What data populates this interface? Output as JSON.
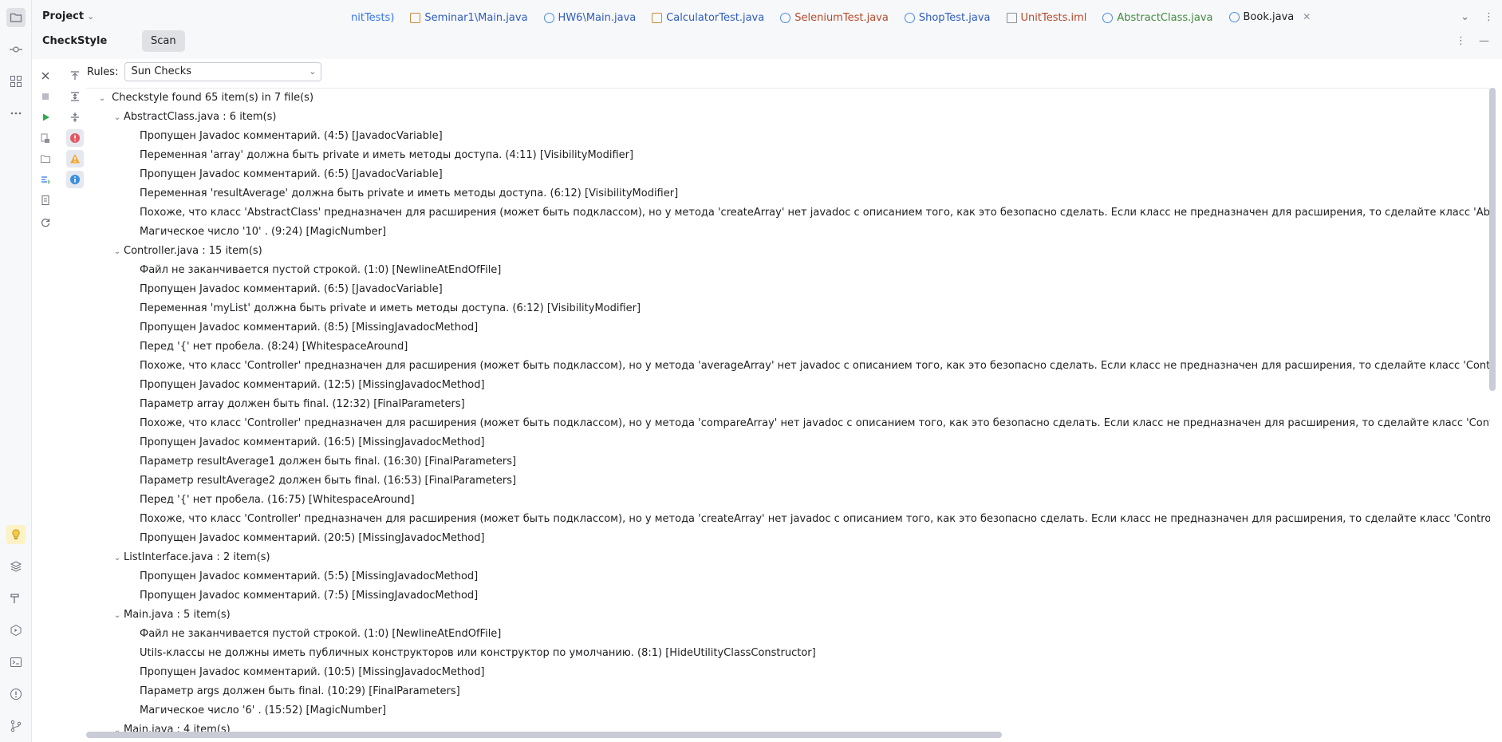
{
  "project": {
    "title": "Project"
  },
  "editor_tabs": [
    {
      "label": "nitTests)",
      "icon": "none",
      "color": "#3574f0"
    },
    {
      "label": "Seminar1\\Main.java",
      "icon": "test",
      "color": "#2f5cbf"
    },
    {
      "label": "HW6\\Main.java",
      "icon": "class",
      "color": "#2f5cbf"
    },
    {
      "label": "CalculatorTest.java",
      "icon": "test",
      "color": "#2f5cbf"
    },
    {
      "label": "SeleniumTest.java",
      "icon": "class",
      "color": "#b54a2a"
    },
    {
      "label": "ShopTest.java",
      "icon": "class",
      "color": "#2f5cbf"
    },
    {
      "label": "UnitTests.iml",
      "icon": "file",
      "color": "#b54a2a"
    },
    {
      "label": "AbstractClass.java",
      "icon": "class",
      "color": "#3f8a3f"
    },
    {
      "label": "Book.java",
      "icon": "class",
      "color": "#1e1f22",
      "active": true
    }
  ],
  "toolwindow": {
    "title": "CheckStyle",
    "tab": "Scan"
  },
  "rules": {
    "label": "Rules:",
    "selected": "Sun Checks"
  },
  "tree": {
    "root": "Checkstyle found 65 item(s) in 7 file(s)",
    "files": [
      {
        "name": "AbstractClass.java : 6 item(s)",
        "items": [
          "Пропущен Javadoc комментарий. (4:5) [JavadocVariable]",
          "Переменная 'array' должна быть private и иметь методы доступа. (4:11) [VisibilityModifier]",
          "Пропущен Javadoc комментарий. (6:5) [JavadocVariable]",
          "Переменная 'resultAverage' должна быть private и иметь методы доступа. (6:12) [VisibilityModifier]",
          "Похоже, что класс 'AbstractClass' предназначен для расширения (может быть подклассом), но у метода 'createArray' нет javadoc с описанием того, как это безопасно сделать. Если класс не предназначен для расширения, то сделайте класс 'AbstractClass' final",
          "Магическое число '10' . (9:24) [MagicNumber]"
        ]
      },
      {
        "name": "Controller.java : 15 item(s)",
        "items": [
          "Файл не заканчивается пустой строкой. (1:0) [NewlineAtEndOfFile]",
          "Пропущен Javadoc комментарий. (6:5) [JavadocVariable]",
          "Переменная 'myList' должна быть private и иметь методы доступа. (6:12) [VisibilityModifier]",
          "Пропущен Javadoc комментарий. (8:5) [MissingJavadocMethod]",
          "Перед '{' нет пробела. (8:24) [WhitespaceAround]",
          "Похоже, что класс 'Controller' предназначен для расширения (может быть подклассом), но у метода 'averageArray' нет javadoc с описанием того, как это безопасно сделать. Если класс не предназначен для расширения, то сделайте класс 'Controller' final или",
          "Пропущен Javadoc комментарий. (12:5) [MissingJavadocMethod]",
          "Параметр array должен быть final. (12:32) [FinalParameters]",
          "Похоже, что класс 'Controller' предназначен для расширения (может быть подклассом), но у метода 'compareArray' нет javadoc с описанием того, как это безопасно сделать. Если класс не предназначен для расширения, то сделайте класс 'Controller' final или",
          "Пропущен Javadoc комментарий. (16:5) [MissingJavadocMethod]",
          "Параметр resultAverage1 должен быть final. (16:30) [FinalParameters]",
          "Параметр resultAverage2 должен быть final. (16:53) [FinalParameters]",
          "Перед '{' нет пробела. (16:75) [WhitespaceAround]",
          "Похоже, что класс 'Controller' предназначен для расширения (может быть подклассом), но у метода 'createArray' нет javadoc с описанием того, как это безопасно сделать. Если класс не предназначен для расширения, то сделайте класс 'Controller' final или",
          "Пропущен Javadoc комментарий. (20:5) [MissingJavadocMethod]"
        ]
      },
      {
        "name": "ListInterface.java : 2 item(s)",
        "items": [
          "Пропущен Javadoc комментарий. (5:5) [MissingJavadocMethod]",
          "Пропущен Javadoc комментарий. (7:5) [MissingJavadocMethod]"
        ]
      },
      {
        "name": "Main.java : 5 item(s)",
        "items": [
          "Файл не заканчивается пустой строкой. (1:0) [NewlineAtEndOfFile]",
          "Utils-классы не должны иметь публичных конструкторов или конструктор по умолчанию. (8:1) [HideUtilityClassConstructor]",
          "Пропущен Javadoc комментарий. (10:5) [MissingJavadocMethod]",
          "Параметр args должен быть final. (10:29) [FinalParameters]",
          "Магическое число '6' . (15:52) [MagicNumber]"
        ]
      },
      {
        "name": "Main.java : 4 item(s)",
        "items": []
      }
    ]
  }
}
